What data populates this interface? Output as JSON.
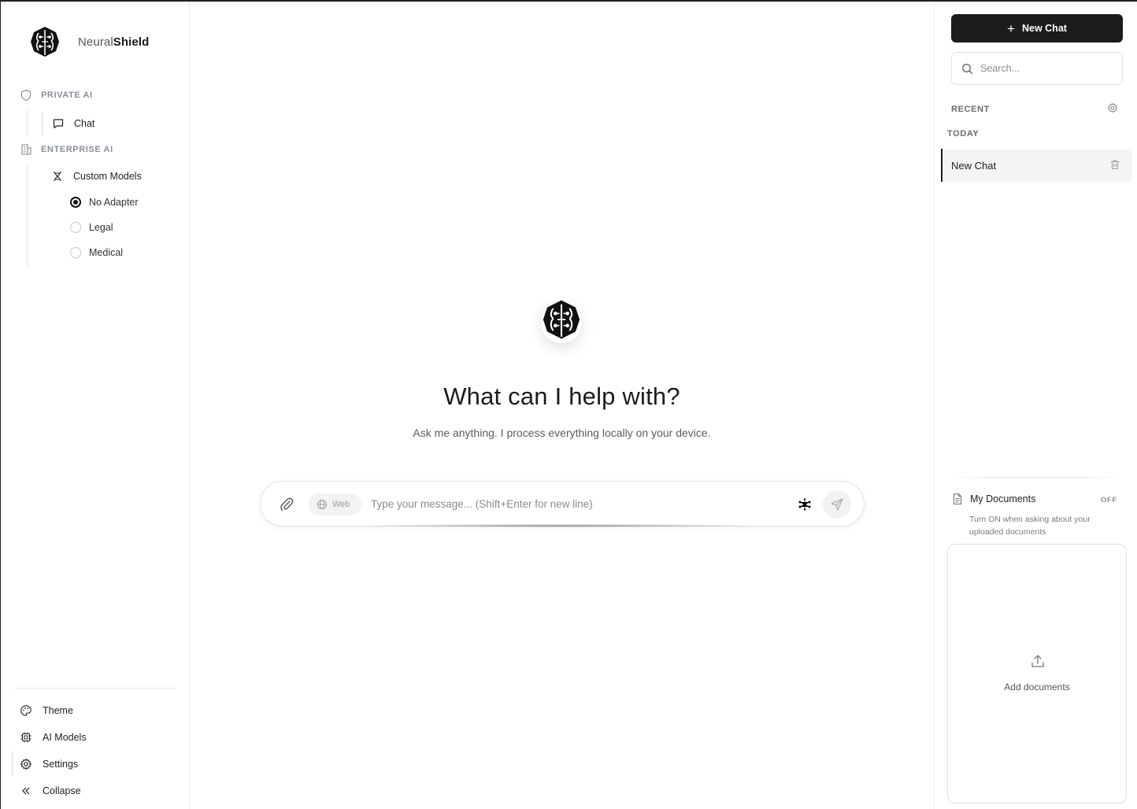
{
  "brand": {
    "name_light": "Neural",
    "name_bold": "Shield"
  },
  "sidebar": {
    "sections": [
      {
        "heading": "PRIVATE AI",
        "icon": "shield-icon"
      },
      {
        "heading": "ENTERPRISE AI",
        "icon": "building-icon"
      }
    ],
    "chat_label": "Chat",
    "custom_models_label": "Custom Models",
    "adapters": [
      {
        "label": "No Adapter",
        "selected": true
      },
      {
        "label": "Legal",
        "selected": false
      },
      {
        "label": "Medical",
        "selected": false
      }
    ],
    "footer": [
      {
        "label": "Theme",
        "icon": "palette-icon"
      },
      {
        "label": "AI Models",
        "icon": "cpu-icon"
      },
      {
        "label": "Settings",
        "icon": "gear-icon"
      },
      {
        "label": "Collapse",
        "icon": "double-chevron-left-icon"
      }
    ]
  },
  "main": {
    "title": "What can I help with?",
    "subtitle": "Ask me anything. I process everything locally on your device.",
    "composer": {
      "web_label": "Web",
      "placeholder": "Type your message... (Shift+Enter for new line)"
    }
  },
  "right": {
    "new_chat_label": "New Chat",
    "search_placeholder": "Search...",
    "recent_label": "RECENT",
    "today_label": "TODAY",
    "conversations": [
      {
        "title": "New Chat"
      }
    ],
    "documents": {
      "title": "My Documents",
      "toggle": "OFF",
      "description": "Turn ON when asking about your uploaded documents",
      "add_label": "Add documents"
    }
  }
}
